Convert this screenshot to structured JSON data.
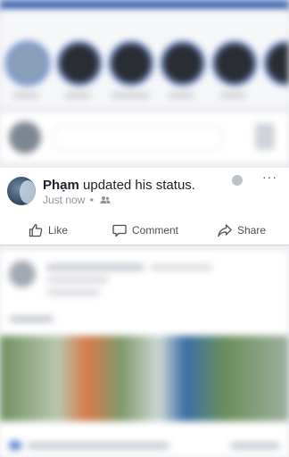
{
  "colors": {
    "brand": "#4267b2",
    "feed_bg": "#e9ebee",
    "text_primary": "#1d2129",
    "text_secondary": "#90949c",
    "action_text": "#4b4f56"
  },
  "post": {
    "author": "Phạm",
    "action_text": "updated his status.",
    "time": "Just now",
    "separator": "•",
    "audience_icon": "friends-icon",
    "more_icon": "more-icon",
    "more_glyph": "···"
  },
  "actions": {
    "like": "Like",
    "comment": "Comment",
    "share": "Share"
  }
}
